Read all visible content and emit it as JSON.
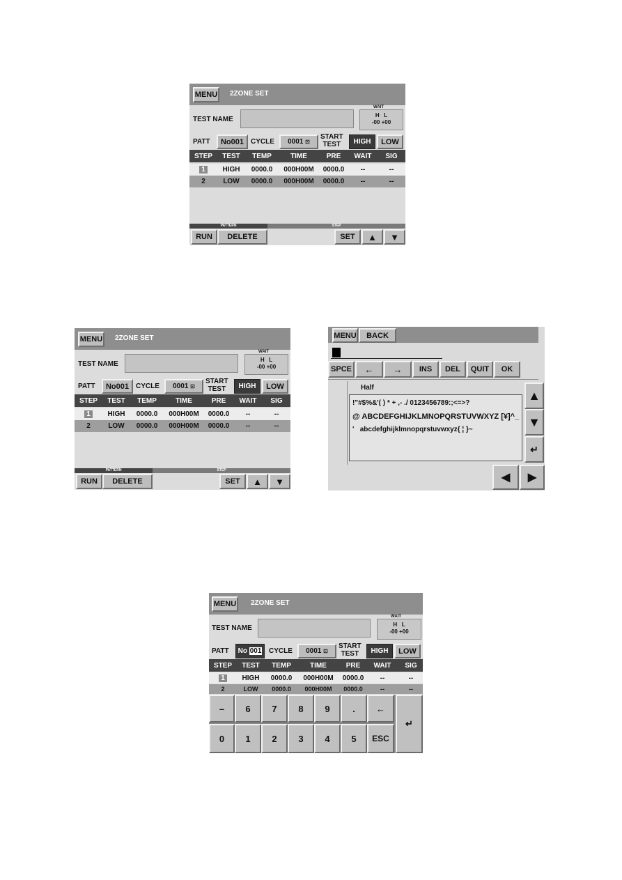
{
  "screens": [
    {
      "header": {
        "menu_label": "MENU",
        "title": "2ZONE SET"
      },
      "test_name": {
        "label": "TEST NAME",
        "value": ""
      },
      "wait_box": {
        "caption": "WAIT",
        "h_label": "H",
        "l_label": "L",
        "h_value": "-00",
        "l_value": "+00"
      },
      "patt": {
        "label": "PATT",
        "value": "No001",
        "value_prefix": "No",
        "value_number": "001"
      },
      "cycle": {
        "label": "CYCLE",
        "value": "0001",
        "icon": "cycle-icon"
      },
      "start_test": {
        "label_line1": "START",
        "label_line2": "TEST",
        "high_label": "HIGH",
        "low_label": "LOW",
        "selected": "HIGH"
      },
      "table": {
        "headers": [
          "STEP",
          "TEST",
          "TEMP",
          "TIME",
          "PRE",
          "WAIT",
          "SIG"
        ],
        "rows": [
          [
            "1",
            "HIGH",
            "0000.0",
            "000H00M",
            "0000.0",
            "--",
            "--"
          ],
          [
            "2",
            "LOW",
            "0000.0",
            "000H00M",
            "0000.0",
            "--",
            "--"
          ]
        ]
      },
      "footer": {
        "pattern_caption": "PATTERN",
        "step_caption": "STEP",
        "run_label": "RUN",
        "delete_label": "DELETE",
        "set_label": "SET",
        "up_icon": "▲",
        "down_icon": "▼"
      }
    }
  ],
  "char_input": {
    "menu_label": "MENU",
    "back_label": "BACK",
    "input_value": "",
    "buttons": [
      "SPCE",
      "←",
      "→",
      "INS",
      "DEL",
      "QUIT",
      "OK"
    ],
    "mode_label": "Half",
    "char_rows": [
      "!\"#$%&'( ) * + ,- ./ 0123456789:;<=>?",
      "@ ABCDEFGHIJKLMNOPQRSTUVWXYZ [¥]^_",
      "'   abcdefghijklmnopqrstuvwxyz{ ¦ }~"
    ],
    "nav": {
      "up": "▲",
      "down": "▼",
      "enter": "↵",
      "left": "◀",
      "right": "▶"
    }
  },
  "numpad": {
    "row1": [
      "–",
      "6",
      "7",
      "8",
      "9",
      ".",
      "←"
    ],
    "row2": [
      "0",
      "1",
      "2",
      "3",
      "4",
      "5",
      "ESC"
    ],
    "enter": "↵"
  }
}
